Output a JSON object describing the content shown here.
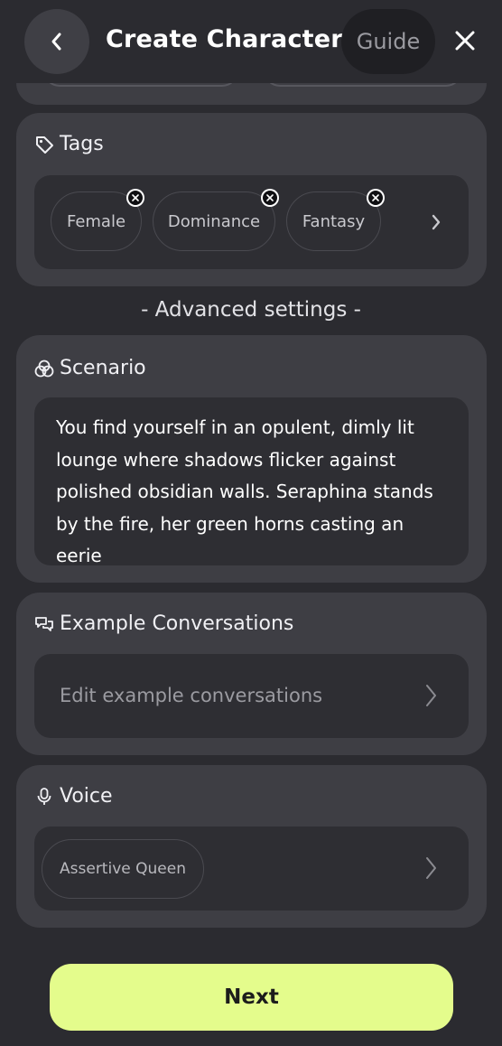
{
  "header": {
    "title": "Create Character",
    "guide_label": "Guide"
  },
  "tags": {
    "heading": "Tags",
    "items": [
      "Female",
      "Dominance",
      "Fantasy"
    ]
  },
  "advanced_label": "- Advanced settings -",
  "scenario": {
    "heading": "Scenario",
    "text": "You find yourself in an opulent, dimly lit lounge where shadows flicker against polished obsidian walls. Seraphina stands by the fire, her green horns casting an eerie"
  },
  "example_conversations": {
    "heading": "Example Conversations",
    "placeholder": "Edit example conversations"
  },
  "voice": {
    "heading": "Voice",
    "selected": "Assertive Queen"
  },
  "next_label": "Next",
  "colors": {
    "background": "#2b2b30",
    "card": "#3e3e44",
    "inner": "#2e2e33",
    "accent": "#e4fc8c"
  }
}
